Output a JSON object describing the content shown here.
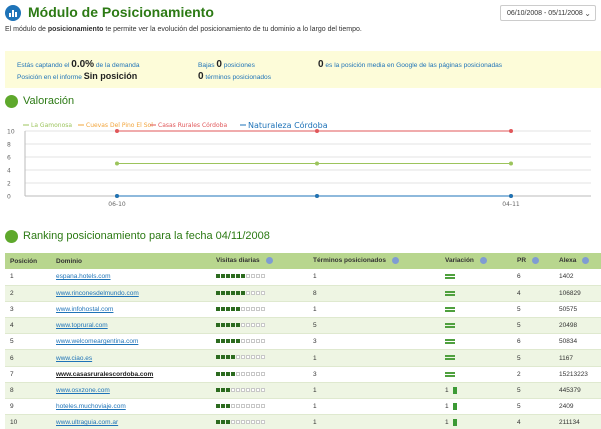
{
  "header": {
    "title": "Módulo de Posicionamiento",
    "desc_pre": "El módulo de ",
    "desc_bold": "posicionamiento",
    "desc_post": " te permite ver la evolución del posicionamiento de tu dominio a lo largo del tiempo.",
    "date_range": "06/10/2008 - 05/11/2008"
  },
  "summary": {
    "captando_pre": "Estás captando el ",
    "captando_value": "0.0%",
    "captando_post": " de la demanda",
    "posicion_label": "Posición en el informe ",
    "posicion_value": "Sin posición",
    "bajas_label": "Bajas ",
    "bajas_value": "0",
    "bajas_unit": " posiciones",
    "terminos_value": "0",
    "terminos_label": " términos posicionados",
    "media_value": "0",
    "media_label": " es la posición media en Google de las páginas posicionadas"
  },
  "valoracion": {
    "title": "Valoración"
  },
  "chart_data": {
    "type": "line",
    "x": [
      "06-10",
      "04-11"
    ],
    "ylim": [
      0,
      10
    ],
    "yticks": [
      "10",
      "8",
      "6",
      "4",
      "2",
      "0"
    ],
    "grid": true,
    "legend_position": "top-left",
    "series": [
      {
        "name": "La Gamonosa",
        "color": "#9cc45c",
        "values": [
          5,
          5,
          5
        ]
      },
      {
        "name": "Cuevas Del Pino El Sol",
        "color": "#f2a43a",
        "values": [
          0,
          0,
          0
        ]
      },
      {
        "name": "Casas Rurales Córdoba",
        "color": "#e0575a",
        "values": [
          10,
          10,
          10
        ]
      },
      {
        "name": "Naturaleza Córdoba",
        "color": "#1e73b8",
        "values": [
          0,
          0,
          0
        ]
      }
    ]
  },
  "ranking": {
    "title": "Ranking posicionamiento para la fecha 04/11/2008",
    "headers": [
      "Posición",
      "Dominio",
      "Visitas diarias",
      "Términos posicionados",
      "Variación",
      "PR",
      "Alexa"
    ],
    "rows": [
      {
        "pos": "1",
        "domain": "espana.hotels.com",
        "visits": 6,
        "terms": "1",
        "variation": "=",
        "var_value": "",
        "pr": "6",
        "alexa": "1402"
      },
      {
        "pos": "2",
        "domain": "www.rinconesdelmundo.com",
        "visits": 6,
        "terms": "8",
        "variation": "=",
        "var_value": "",
        "pr": "4",
        "alexa": "106829"
      },
      {
        "pos": "3",
        "domain": "www.infohostal.com",
        "visits": 5,
        "terms": "1",
        "variation": "=",
        "var_value": "",
        "pr": "5",
        "alexa": "50575"
      },
      {
        "pos": "4",
        "domain": "www.toprural.com",
        "visits": 5,
        "terms": "5",
        "variation": "=",
        "var_value": "",
        "pr": "5",
        "alexa": "20498"
      },
      {
        "pos": "5",
        "domain": "www.welcomeargentina.com",
        "visits": 5,
        "terms": "3",
        "variation": "=",
        "var_value": "",
        "pr": "6",
        "alexa": "50834"
      },
      {
        "pos": "6",
        "domain": "www.ciao.es",
        "visits": 4,
        "terms": "1",
        "variation": "=",
        "var_value": "",
        "pr": "5",
        "alexa": "1167"
      },
      {
        "pos": "7",
        "domain": "www.casasruralescordoba.com",
        "visits": 4,
        "terms": "3",
        "variation": "=",
        "var_value": "",
        "pr": "2",
        "alexa": "15213223",
        "bold": true
      },
      {
        "pos": "8",
        "domain": "www.osxzone.com",
        "visits": 3,
        "terms": "1",
        "variation": "up",
        "var_value": "1",
        "pr": "5",
        "alexa": "445379"
      },
      {
        "pos": "9",
        "domain": "hoteles.muchoviaje.com",
        "visits": 3,
        "terms": "1",
        "variation": "up",
        "var_value": "1",
        "pr": "5",
        "alexa": "2409"
      },
      {
        "pos": "10",
        "domain": "www.ultraguia.com.ar",
        "visits": 3,
        "terms": "1",
        "variation": "up",
        "var_value": "1",
        "pr": "4",
        "alexa": "211134"
      }
    ]
  }
}
